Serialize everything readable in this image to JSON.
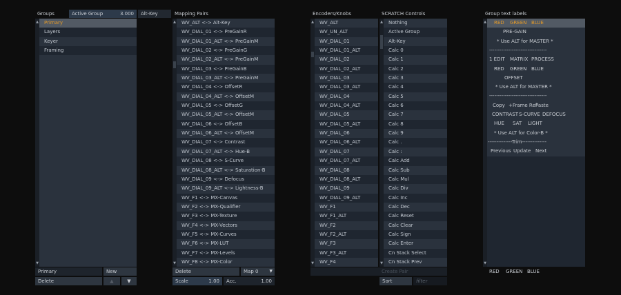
{
  "groups": {
    "header": "Groups",
    "active_group_label": "Active Group",
    "active_group_value": "3.000",
    "altkey_label": "Alt-Key",
    "items": [
      "Primary",
      "Layers",
      "Keyer",
      "Framing"
    ],
    "selected_index": 0,
    "name_field_value": "Primary",
    "new_label": "New",
    "delete_label": "Delete"
  },
  "mapping": {
    "header": "Mapping Pairs",
    "items": [
      "WV_ALT <-> Alt-Key",
      "WV_DIAL_01 <-> PreGainR",
      "WV_DIAL_01_ALT <-> PreGainM",
      "WV_DIAL_02 <-> PreGainG",
      "WV_DIAL_02_ALT <-> PreGainM",
      "WV_DIAL_03 <-> PreGainB",
      "WV_DIAL_03_ALT <-> PreGainM",
      "WV_DIAL_04 <-> OffsetR",
      "WV_DIAL_04_ALT <-> OffsetM",
      "WV_DIAL_05 <-> OffsetG",
      "WV_DIAL_05_ALT <-> OffsetM",
      "WV_DIAL_06 <-> OffsetB",
      "WV_DIAL_06_ALT <-> OffsetM",
      "WV_DIAL_07 <-> Contrast",
      "WV_DIAL_07_ALT <-> Hue-B",
      "WV_DIAL_08 <-> S-Curve",
      "WV_DIAL_08_ALT <-> Saturation-B",
      "WV_DIAL_09 <-> Defocus",
      "WV_DIAL_09_ALT <-> Lightness-B",
      "WV_F1 <-> MX-Canvas",
      "WV_F2 <-> MX-Qualifier",
      "WV_F3 <-> MX-Texture",
      "WV_F4 <-> MX-Vectors",
      "WV_F5 <-> MX-Curves",
      "WV_F6 <-> MX-LUT",
      "WV_F7 <-> MX-Levels",
      "WV_F8 <-> MX-Color"
    ],
    "delete_label": "Delete",
    "map_label": "Map 0",
    "scale_label": "Scale",
    "scale_value": "1.00",
    "acc_label": "Acc.",
    "acc_value": "1.00"
  },
  "encoders": {
    "header": "Encoders/Knobs",
    "items": [
      "WV_ALT",
      "WV_UN_ALT",
      "WV_DIAL_01",
      "WV_DIAL_01_ALT",
      "WV_DIAL_02",
      "WV_DIAL_02_ALT",
      "WV_DIAL_03",
      "WV_DIAL_03_ALT",
      "WV_DIAL_04",
      "WV_DIAL_04_ALT",
      "WV_DIAL_05",
      "WV_DIAL_05_ALT",
      "WV_DIAL_06",
      "WV_DIAL_06_ALT",
      "WV_DIAL_07",
      "WV_DIAL_07_ALT",
      "WV_DIAL_08",
      "WV_DIAL_08_ALT",
      "WV_DIAL_09",
      "WV_DIAL_09_ALT",
      "WV_F1",
      "WV_F1_ALT",
      "WV_F2",
      "WV_F2_ALT",
      "WV_F3",
      "WV_F3_ALT",
      "WV_F4"
    ]
  },
  "scratch": {
    "header": "SCRATCH Controls",
    "items": [
      "Nothing",
      "Active Group",
      "Alt-Key",
      "Calc 0",
      "Calc 1",
      "Calc 2",
      "Calc 3",
      "Calc 4",
      "Calc 5",
      "Calc 6",
      "Calc 7",
      "Calc 8",
      "Calc 9",
      "Calc .",
      "Calc :",
      "Calc Add",
      "Calc Sub",
      "Calc Mul",
      "Calc Div",
      "Calc Inc",
      "Calc Dec",
      "Calc Reset",
      "Calc Clear",
      "Calc Sign",
      "Calc Enter",
      "Cn Stack Select",
      "Cn Stack Prev"
    ],
    "create_placeholder": "Create Pair",
    "sort_label": "Sort",
    "filter_placeholder": "filter"
  },
  "group_text": {
    "header": "Group text labels",
    "lines": [
      [
        "RED",
        "GREEN",
        "BLUE"
      ],
      [
        "PRE-GAIN"
      ],
      [
        "* Use ALT for MASTER *"
      ],
      [
        "---------------------------------"
      ],
      [
        "1 EDIT",
        "MATRIX",
        "PROCESS"
      ],
      [
        "RED",
        "GREEN",
        "BLUE"
      ],
      [
        "OFFSET"
      ],
      [
        "* Use ALT for MASTER *"
      ],
      [
        "---------------------------------"
      ],
      [
        "Copy",
        "+Frame Ref",
        "Paste"
      ],
      [
        "CONTRAST",
        "S-CURVE",
        "DEFOCUS"
      ],
      [
        "HUE",
        "SAT",
        "LIGHT"
      ],
      [
        "* Use ALT for Color-B *"
      ],
      [
        "--------------Trim--------------"
      ],
      [
        "Previous",
        "Update",
        "Next"
      ]
    ],
    "footer": [
      "RED",
      "GREEN",
      "BLUE"
    ]
  }
}
